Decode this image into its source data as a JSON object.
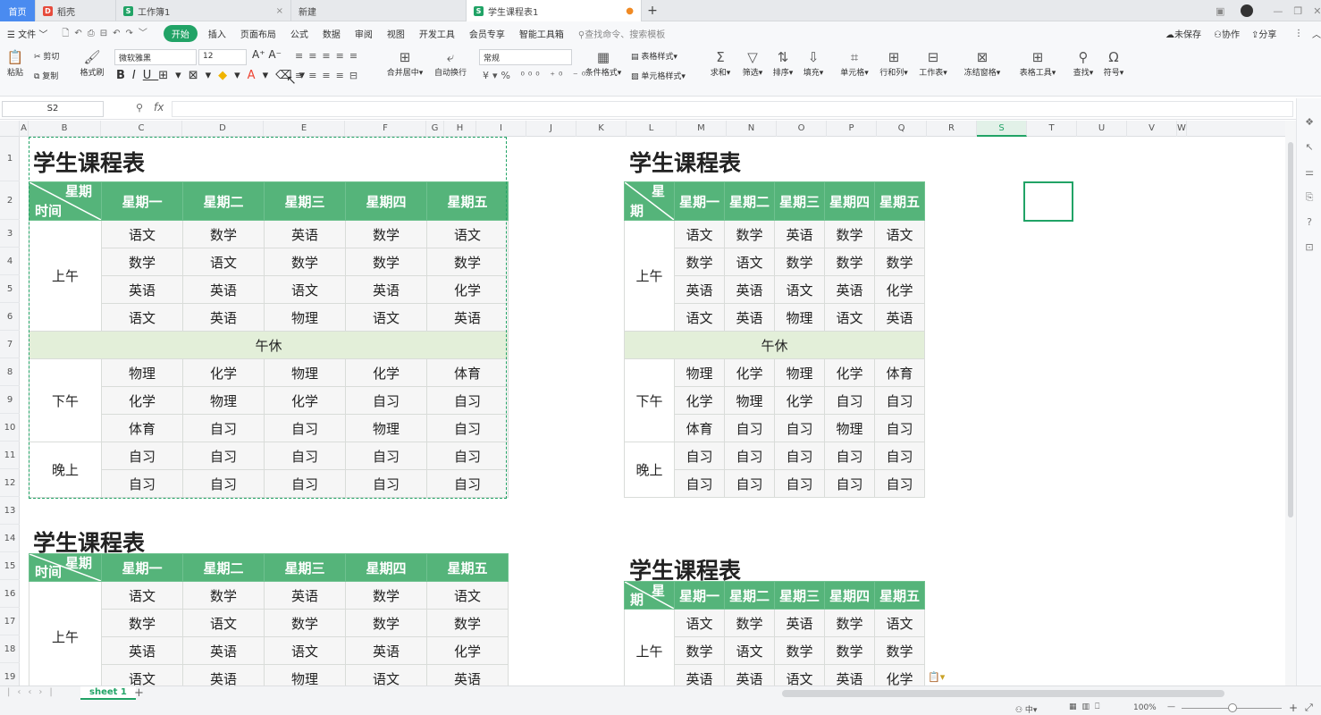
{
  "tabs": [
    {
      "label": "首页"
    },
    {
      "label": "稻壳"
    },
    {
      "label": "工作簿1"
    },
    {
      "label": "新建"
    },
    {
      "label": "学生课程表1"
    }
  ],
  "menus": [
    "文件",
    "开始",
    "插入",
    "页面布局",
    "公式",
    "数据",
    "审阅",
    "视图",
    "开发工具",
    "会员专享",
    "智能工具箱"
  ],
  "search_placeholder": "查找命令、搜索模板",
  "right_actions": {
    "unsaved": "未保存",
    "collab": "协作",
    "share": "分享"
  },
  "toolbar": {
    "paste": "粘贴",
    "cut": "剪切",
    "copy": "复制",
    "format_painter": "格式刷",
    "font": "微软雅黑",
    "size": "12",
    "number_format": "常规",
    "merge": "合并居中",
    "wrap": "自动换行",
    "cond_format": "条件格式",
    "table_style": "表格样式",
    "cell_style": "单元格样式",
    "sum": "求和",
    "filter": "筛选",
    "sort": "排序",
    "fill": "填充",
    "cell": "单元格",
    "rowcol": "行和列",
    "worksheet": "工作表",
    "freeze": "冻结窗格",
    "table_tools": "表格工具",
    "find": "查找",
    "symbol": "符号"
  },
  "name_box": "S2",
  "columns": [
    "A",
    "B",
    "C",
    "D",
    "E",
    "F",
    "G",
    "H",
    "I",
    "J",
    "K",
    "L",
    "M",
    "N",
    "O",
    "P",
    "Q",
    "R",
    "S",
    "T",
    "U",
    "V",
    "W"
  ],
  "rows": [
    "1",
    "2",
    "3",
    "4",
    "5",
    "6",
    "7",
    "8",
    "9",
    "10",
    "11",
    "12",
    "13",
    "14",
    "15",
    "16",
    "17",
    "18",
    "19"
  ],
  "schedule": {
    "title": "学生课程表",
    "corner_top": "星期",
    "corner_bottom": "时间",
    "right_corner_top": "星",
    "right_corner_bottom": "期",
    "days": [
      "星期一",
      "星期二",
      "星期三",
      "星期四",
      "星期五"
    ],
    "periods": {
      "morning": "上午",
      "noon": "午休",
      "afternoon": "下午",
      "evening": "晚上"
    },
    "rows": [
      [
        "语文",
        "数学",
        "英语",
        "数学",
        "语文"
      ],
      [
        "数学",
        "语文",
        "数学",
        "数学",
        "数学"
      ],
      [
        "英语",
        "英语",
        "语文",
        "英语",
        "化学"
      ],
      [
        "语文",
        "英语",
        "物理",
        "语文",
        "英语"
      ],
      [
        "物理",
        "化学",
        "物理",
        "化学",
        "体育"
      ],
      [
        "化学",
        "物理",
        "化学",
        "自习",
        "自习"
      ],
      [
        "体育",
        "自习",
        "自习",
        "物理",
        "自习"
      ],
      [
        "自习",
        "自习",
        "自习",
        "自习",
        "自习"
      ],
      [
        "自习",
        "自习",
        "自习",
        "自习",
        "自习"
      ]
    ]
  },
  "sheet_tab": "sheet 1",
  "zoom": "100%"
}
